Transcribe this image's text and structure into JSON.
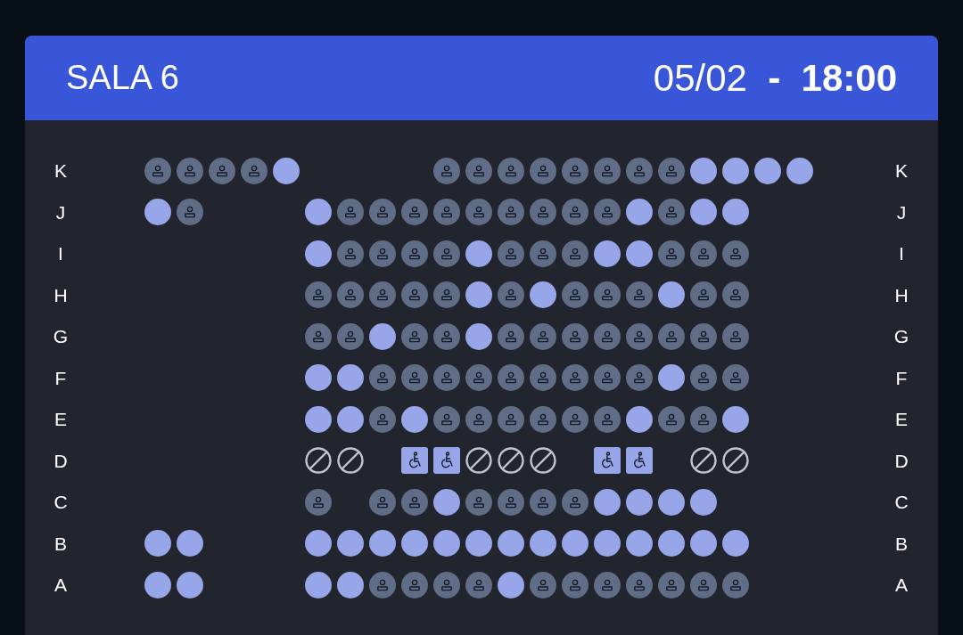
{
  "header": {
    "title": "SALA 6",
    "datetime": "05/02  **-  18:00**"
  },
  "rows": [
    {
      "label": "K",
      "label_right": "K",
      "seats": [
        {
          "kind": "taken"
        },
        {
          "kind": "taken"
        },
        {
          "kind": "taken"
        },
        {
          "kind": "taken"
        },
        {
          "kind": "free"
        },
        {
          "kind": "gap"
        },
        {
          "kind": "gap"
        },
        {
          "kind": "gap"
        },
        {
          "kind": "gap"
        },
        {
          "kind": "taken"
        },
        {
          "kind": "taken"
        },
        {
          "kind": "taken"
        },
        {
          "kind": "taken"
        },
        {
          "kind": "taken"
        },
        {
          "kind": "taken"
        },
        {
          "kind": "taken"
        },
        {
          "kind": "taken"
        },
        {
          "kind": "free"
        },
        {
          "kind": "free"
        },
        {
          "kind": "free"
        },
        {
          "kind": "free"
        }
      ]
    },
    {
      "label": "J",
      "label_right": "J",
      "seats": [
        {
          "kind": "free"
        },
        {
          "kind": "taken"
        },
        {
          "kind": "gap"
        },
        {
          "kind": "gap"
        },
        {
          "kind": "gap"
        },
        {
          "kind": "free"
        },
        {
          "kind": "taken"
        },
        {
          "kind": "taken"
        },
        {
          "kind": "taken"
        },
        {
          "kind": "taken"
        },
        {
          "kind": "taken"
        },
        {
          "kind": "taken"
        },
        {
          "kind": "taken"
        },
        {
          "kind": "taken"
        },
        {
          "kind": "taken"
        },
        {
          "kind": "free"
        },
        {
          "kind": "taken"
        },
        {
          "kind": "free"
        },
        {
          "kind": "free"
        }
      ]
    },
    {
      "label": "I",
      "label_right": "I",
      "seats": [
        {
          "kind": "gap"
        },
        {
          "kind": "gap"
        },
        {
          "kind": "gap"
        },
        {
          "kind": "gap"
        },
        {
          "kind": "gap"
        },
        {
          "kind": "free"
        },
        {
          "kind": "taken"
        },
        {
          "kind": "taken"
        },
        {
          "kind": "taken"
        },
        {
          "kind": "taken"
        },
        {
          "kind": "free"
        },
        {
          "kind": "taken"
        },
        {
          "kind": "taken"
        },
        {
          "kind": "taken"
        },
        {
          "kind": "free"
        },
        {
          "kind": "free"
        },
        {
          "kind": "taken"
        },
        {
          "kind": "taken"
        },
        {
          "kind": "taken"
        }
      ]
    },
    {
      "label": "H",
      "label_right": "H",
      "seats": [
        {
          "kind": "gap"
        },
        {
          "kind": "gap"
        },
        {
          "kind": "gap"
        },
        {
          "kind": "gap"
        },
        {
          "kind": "gap"
        },
        {
          "kind": "taken"
        },
        {
          "kind": "taken"
        },
        {
          "kind": "taken"
        },
        {
          "kind": "taken"
        },
        {
          "kind": "taken"
        },
        {
          "kind": "free"
        },
        {
          "kind": "taken"
        },
        {
          "kind": "free"
        },
        {
          "kind": "taken"
        },
        {
          "kind": "taken"
        },
        {
          "kind": "taken"
        },
        {
          "kind": "free"
        },
        {
          "kind": "taken"
        },
        {
          "kind": "taken"
        }
      ]
    },
    {
      "label": "G",
      "label_right": "G",
      "seats": [
        {
          "kind": "gap"
        },
        {
          "kind": "gap"
        },
        {
          "kind": "gap"
        },
        {
          "kind": "gap"
        },
        {
          "kind": "gap"
        },
        {
          "kind": "taken"
        },
        {
          "kind": "taken"
        },
        {
          "kind": "free"
        },
        {
          "kind": "taken"
        },
        {
          "kind": "taken"
        },
        {
          "kind": "free"
        },
        {
          "kind": "taken"
        },
        {
          "kind": "taken"
        },
        {
          "kind": "taken"
        },
        {
          "kind": "taken"
        },
        {
          "kind": "taken"
        },
        {
          "kind": "taken"
        },
        {
          "kind": "taken"
        },
        {
          "kind": "taken"
        }
      ]
    },
    {
      "label": "F",
      "label_right": "F",
      "seats": [
        {
          "kind": "gap"
        },
        {
          "kind": "gap"
        },
        {
          "kind": "gap"
        },
        {
          "kind": "gap"
        },
        {
          "kind": "gap"
        },
        {
          "kind": "free"
        },
        {
          "kind": "free"
        },
        {
          "kind": "taken"
        },
        {
          "kind": "taken"
        },
        {
          "kind": "taken"
        },
        {
          "kind": "taken"
        },
        {
          "kind": "taken"
        },
        {
          "kind": "taken"
        },
        {
          "kind": "taken"
        },
        {
          "kind": "taken"
        },
        {
          "kind": "taken"
        },
        {
          "kind": "free"
        },
        {
          "kind": "taken"
        },
        {
          "kind": "taken"
        }
      ]
    },
    {
      "label": "E",
      "label_right": "E",
      "seats": [
        {
          "kind": "gap"
        },
        {
          "kind": "gap"
        },
        {
          "kind": "gap"
        },
        {
          "kind": "gap"
        },
        {
          "kind": "gap"
        },
        {
          "kind": "free"
        },
        {
          "kind": "free"
        },
        {
          "kind": "taken"
        },
        {
          "kind": "free"
        },
        {
          "kind": "taken"
        },
        {
          "kind": "taken"
        },
        {
          "kind": "taken"
        },
        {
          "kind": "taken"
        },
        {
          "kind": "taken"
        },
        {
          "kind": "taken"
        },
        {
          "kind": "free"
        },
        {
          "kind": "taken"
        },
        {
          "kind": "taken"
        },
        {
          "kind": "free"
        }
      ]
    },
    {
      "label": "D",
      "label_right": "D",
      "seats": [
        {
          "kind": "gap"
        },
        {
          "kind": "gap"
        },
        {
          "kind": "gap"
        },
        {
          "kind": "gap"
        },
        {
          "kind": "gap"
        },
        {
          "kind": "blocked"
        },
        {
          "kind": "blocked"
        },
        {
          "kind": "gap"
        },
        {
          "kind": "wheelchair"
        },
        {
          "kind": "wheelchair"
        },
        {
          "kind": "blocked"
        },
        {
          "kind": "blocked"
        },
        {
          "kind": "blocked"
        },
        {
          "kind": "gap"
        },
        {
          "kind": "wheelchair"
        },
        {
          "kind": "wheelchair"
        },
        {
          "kind": "gap"
        },
        {
          "kind": "blocked"
        },
        {
          "kind": "blocked"
        }
      ]
    },
    {
      "label": "C",
      "label_right": "C",
      "seats": [
        {
          "kind": "gap"
        },
        {
          "kind": "gap"
        },
        {
          "kind": "gap"
        },
        {
          "kind": "gap"
        },
        {
          "kind": "gap"
        },
        {
          "kind": "taken"
        },
        {
          "kind": "gap"
        },
        {
          "kind": "taken"
        },
        {
          "kind": "taken"
        },
        {
          "kind": "free"
        },
        {
          "kind": "taken"
        },
        {
          "kind": "taken"
        },
        {
          "kind": "taken"
        },
        {
          "kind": "taken"
        },
        {
          "kind": "free"
        },
        {
          "kind": "free"
        },
        {
          "kind": "free"
        },
        {
          "kind": "free"
        }
      ]
    },
    {
      "label": "B",
      "label_right": "B",
      "seats": [
        {
          "kind": "free"
        },
        {
          "kind": "free"
        },
        {
          "kind": "gap"
        },
        {
          "kind": "gap"
        },
        {
          "kind": "gap"
        },
        {
          "kind": "free"
        },
        {
          "kind": "free"
        },
        {
          "kind": "free"
        },
        {
          "kind": "free"
        },
        {
          "kind": "free"
        },
        {
          "kind": "free"
        },
        {
          "kind": "free"
        },
        {
          "kind": "free"
        },
        {
          "kind": "free"
        },
        {
          "kind": "free"
        },
        {
          "kind": "free"
        },
        {
          "kind": "free"
        },
        {
          "kind": "free"
        },
        {
          "kind": "free"
        }
      ]
    },
    {
      "label": "A",
      "label_right": "A",
      "seats": [
        {
          "kind": "free"
        },
        {
          "kind": "free"
        },
        {
          "kind": "gap"
        },
        {
          "kind": "gap"
        },
        {
          "kind": "gap"
        },
        {
          "kind": "free"
        },
        {
          "kind": "free"
        },
        {
          "kind": "taken"
        },
        {
          "kind": "taken"
        },
        {
          "kind": "taken"
        },
        {
          "kind": "taken"
        },
        {
          "kind": "free"
        },
        {
          "kind": "taken"
        },
        {
          "kind": "taken"
        },
        {
          "kind": "taken"
        },
        {
          "kind": "taken"
        },
        {
          "kind": "taken"
        },
        {
          "kind": "taken"
        },
        {
          "kind": "taken"
        }
      ]
    }
  ]
}
